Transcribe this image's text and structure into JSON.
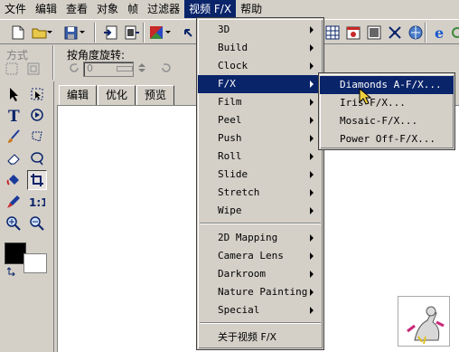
{
  "menubar": {
    "items": [
      "文件",
      "编辑",
      "查看",
      "对象",
      "帧",
      "过滤器",
      "视频 F/X",
      "帮助"
    ],
    "active_index": 6
  },
  "toolbar2": {
    "mode_label": "方式",
    "rotate_label": "按角度旋转:",
    "rotate_value": "0"
  },
  "tabs": [
    "编辑",
    "优化",
    "预览"
  ],
  "video_fx_menu": {
    "group1": [
      "3D",
      "Build",
      "Clock",
      "F/X",
      "Film",
      "Peel",
      "Push",
      "Roll",
      "Slide",
      "Stretch",
      "Wipe"
    ],
    "group2": [
      "2D Mapping",
      "Camera Lens",
      "Darkroom",
      "Nature Painting",
      "Special"
    ],
    "about": "关于视频 F/X",
    "highlighted": "F/X"
  },
  "fx_submenu": {
    "items": [
      "Diamonds A-F/X...",
      "Iris F/X...",
      "Mosaic-F/X...",
      "Power Off-F/X..."
    ],
    "highlighted": "Diamonds A-F/X..."
  },
  "colors": {
    "menu_highlight": "#0a246a",
    "face": "#d4d0c8",
    "foreground_swatch": "#000000",
    "background_swatch": "#ffffff"
  },
  "icons": {
    "toolbar": [
      "new-file-icon",
      "open-folder-icon",
      "save-icon",
      "import-icon",
      "export-icon",
      "color-icon",
      "undo-icon"
    ],
    "toolbar_right": [
      "grid-icon",
      "calendar-icon",
      "preview-icon",
      "transform-icon",
      "web-icon",
      "internet-explorer-icon",
      "refresh-icon"
    ],
    "tools": [
      "arrow-select-icon",
      "marquee-icon",
      "text-icon",
      "play-icon",
      "brush-icon",
      "lasso-icon",
      "eraser-icon",
      "ellipse-icon",
      "fill-bucket-icon",
      "crop-icon",
      "eyedropper-icon",
      "actual-size-icon",
      "zoom-in-icon",
      "zoom-out-icon"
    ]
  }
}
